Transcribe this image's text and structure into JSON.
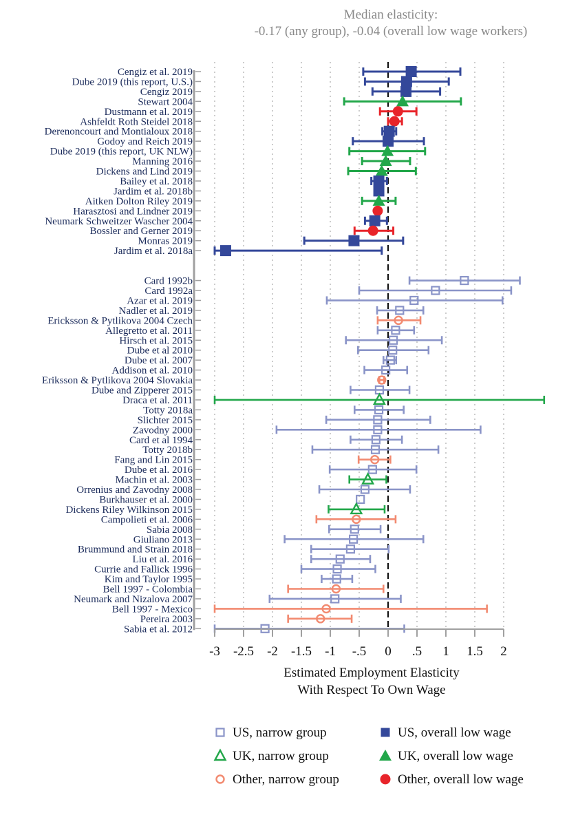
{
  "chart_data": {
    "type": "scatter",
    "subtype": "forest-plot",
    "title": "",
    "annotation": [
      "Median elasticity:",
      "-0.17 (any group), -0.04 (overall low wage workers)"
    ],
    "xlabel": [
      "Estimated Employment Elasticity",
      "With Respect To Own Wage"
    ],
    "ylabel": "",
    "xlim": [
      -3,
      2
    ],
    "xticks": [
      -3,
      -2.5,
      -2,
      -1.5,
      -1,
      -0.5,
      0,
      0.5,
      1,
      1.5,
      2
    ],
    "xtick_labels": [
      "-3",
      "-2.5",
      "-2",
      "-1.5",
      "-1",
      "-.5",
      "0",
      ".5",
      "1",
      "1.5",
      "2"
    ],
    "grid": "vertical dotted",
    "reference_line": {
      "x": 0,
      "style": "dashed",
      "color": "#111111"
    },
    "legend_position": "bottom",
    "series_styles": {
      "us_narrow": {
        "label": "US, narrow group",
        "color": "#8a94c8",
        "marker": "square-hollow"
      },
      "us_overall": {
        "label": "US, overall low wage",
        "color": "#34489a",
        "marker": "square-filled"
      },
      "uk_narrow": {
        "label": "UK, narrow group",
        "color": "#22a74a",
        "marker": "triangle-hollow"
      },
      "uk_overall": {
        "label": "UK, overall low wage",
        "color": "#22a74a",
        "marker": "triangle-filled"
      },
      "other_narrow": {
        "label": "Other, narrow group",
        "color": "#f28a70",
        "marker": "circle-hollow"
      },
      "other_overall": {
        "label": "Other, overall low wage",
        "color": "#e8242a",
        "marker": "circle-filled"
      }
    },
    "legend_order": [
      "us_narrow",
      "us_overall",
      "uk_narrow",
      "uk_overall",
      "other_narrow",
      "other_overall"
    ],
    "groups": [
      {
        "name": "overall low wage",
        "studies": [
          {
            "label": "Cengiz et al. 2019",
            "series": "us_overall",
            "estimate": 0.4,
            "ci": [
              -0.43,
              1.25
            ]
          },
          {
            "label": "Dube 2019 (this report, U.S.)",
            "series": "us_overall",
            "estimate": 0.32,
            "ci": [
              -0.4,
              1.05
            ]
          },
          {
            "label": "Cengiz 2019",
            "series": "us_overall",
            "estimate": 0.31,
            "ci": [
              -0.27,
              0.9
            ]
          },
          {
            "label": "Stewart 2004",
            "series": "uk_overall",
            "estimate": 0.25,
            "ci": [
              -0.76,
              1.26
            ]
          },
          {
            "label": "Dustmann et al. 2019",
            "series": "other_overall",
            "estimate": 0.17,
            "ci": [
              -0.14,
              0.49
            ]
          },
          {
            "label": "Ashfeldt Roth Steidel 2018",
            "series": "other_overall",
            "estimate": 0.11,
            "ci": [
              0.0,
              0.24
            ]
          },
          {
            "label": "Derenoncourt and Montialoux 2018",
            "series": "us_overall",
            "estimate": 0.02,
            "ci": [
              -0.1,
              0.14
            ]
          },
          {
            "label": "Godoy and Reich 2019",
            "series": "us_overall",
            "estimate": 0.0,
            "ci": [
              -0.61,
              0.62
            ]
          },
          {
            "label": "Dube 2019 (this report, UK NLW)",
            "series": "uk_overall",
            "estimate": -0.01,
            "ci": [
              -0.67,
              0.64
            ]
          },
          {
            "label": "Manning 2016",
            "series": "uk_overall",
            "estimate": -0.04,
            "ci": [
              -0.45,
              0.38
            ]
          },
          {
            "label": "Dickens and Lind 2019",
            "series": "uk_overall",
            "estimate": -0.11,
            "ci": [
              -0.69,
              0.48
            ]
          },
          {
            "label": "Bailey et al. 2018",
            "series": "us_overall",
            "estimate": -0.16,
            "ci": [
              -0.29,
              -0.02
            ]
          },
          {
            "label": "Jardim et al. 2018b",
            "series": "us_overall",
            "estimate": -0.16,
            "ci": [
              -0.16,
              -0.16
            ]
          },
          {
            "label": "Aitken Dolton Riley 2019",
            "series": "uk_overall",
            "estimate": -0.16,
            "ci": [
              -0.45,
              0.13
            ]
          },
          {
            "label": "Harasztosi and Lindner 2019",
            "series": "other_overall",
            "estimate": -0.18,
            "ci": [
              -0.18,
              -0.18
            ]
          },
          {
            "label": "Neumark Schweitzer Wascher 2004",
            "series": "us_overall",
            "estimate": -0.23,
            "ci": [
              -0.4,
              -0.02
            ]
          },
          {
            "label": "Bossler and Gerner 2019",
            "series": "other_overall",
            "estimate": -0.26,
            "ci": [
              -0.58,
              0.09
            ]
          },
          {
            "label": "Monras 2019",
            "series": "us_overall",
            "estimate": -0.59,
            "ci": [
              -1.45,
              0.26
            ]
          },
          {
            "label": "Jardim et al. 2018a",
            "series": "us_overall",
            "estimate": -2.81,
            "ci": [
              -3.0,
              -0.11
            ]
          }
        ]
      },
      {
        "name": "narrow group",
        "studies": [
          {
            "label": "Card 1992b",
            "series": "us_narrow",
            "estimate": 1.32,
            "ci": [
              0.37,
              2.28
            ]
          },
          {
            "label": "Card 1992a",
            "series": "us_narrow",
            "estimate": 0.82,
            "ci": [
              -0.5,
              2.13
            ]
          },
          {
            "label": "Azar et al. 2019",
            "series": "us_narrow",
            "estimate": 0.45,
            "ci": [
              -1.06,
              1.98
            ]
          },
          {
            "label": "Nadler et al. 2019",
            "series": "us_narrow",
            "estimate": 0.2,
            "ci": [
              -0.19,
              0.61
            ]
          },
          {
            "label": "Ericksson & Pytlikova 2004 Czech",
            "series": "other_narrow",
            "estimate": 0.18,
            "ci": [
              -0.18,
              0.56
            ]
          },
          {
            "label": "Allegretto et al. 2011",
            "series": "us_narrow",
            "estimate": 0.13,
            "ci": [
              -0.18,
              0.45
            ]
          },
          {
            "label": "Hirsch et al. 2015",
            "series": "us_narrow",
            "estimate": 0.09,
            "ci": [
              -0.73,
              0.93
            ]
          },
          {
            "label": "Dube et al 2010",
            "series": "us_narrow",
            "estimate": 0.08,
            "ci": [
              -0.52,
              0.7
            ]
          },
          {
            "label": "Dube et al. 2007",
            "series": "us_narrow",
            "estimate": 0.04,
            "ci": [
              -0.08,
              0.14
            ]
          },
          {
            "label": "Addison et al. 2010",
            "series": "us_narrow",
            "estimate": -0.04,
            "ci": [
              -0.41,
              0.33
            ]
          },
          {
            "label": "Eriksson & Pytlikova 2004 Slovakia",
            "series": "other_narrow",
            "estimate": -0.11,
            "ci": [
              -0.15,
              -0.07
            ]
          },
          {
            "label": "Dube and Zipperer 2015",
            "series": "us_narrow",
            "estimate": -0.15,
            "ci": [
              -0.65,
              0.37
            ]
          },
          {
            "label": "Draca et al. 2011",
            "series": "uk_narrow",
            "estimate": -0.15,
            "ci": [
              -3.0,
              2.7
            ]
          },
          {
            "label": "Totty 2018a",
            "series": "us_narrow",
            "estimate": -0.16,
            "ci": [
              -0.58,
              0.27
            ]
          },
          {
            "label": "Slichter 2015",
            "series": "us_narrow",
            "estimate": -0.18,
            "ci": [
              -1.07,
              0.73
            ]
          },
          {
            "label": "Zavodny 2000",
            "series": "us_narrow",
            "estimate": -0.18,
            "ci": [
              -1.93,
              1.6
            ]
          },
          {
            "label": "Card et al 1994",
            "series": "us_narrow",
            "estimate": -0.21,
            "ci": [
              -0.65,
              0.24
            ]
          },
          {
            "label": "Totty 2018b",
            "series": "us_narrow",
            "estimate": -0.22,
            "ci": [
              -1.31,
              0.87
            ]
          },
          {
            "label": "Fang and Lin 2015",
            "series": "other_narrow",
            "estimate": -0.23,
            "ci": [
              -0.51,
              0.04
            ]
          },
          {
            "label": "Dube et al. 2016",
            "series": "us_narrow",
            "estimate": -0.27,
            "ci": [
              -1.01,
              0.49
            ]
          },
          {
            "label": "Machin et al. 2003",
            "series": "uk_narrow",
            "estimate": -0.35,
            "ci": [
              -0.67,
              -0.03
            ]
          },
          {
            "label": "Orrenius and Zavodny 2008",
            "series": "us_narrow",
            "estimate": -0.4,
            "ci": [
              -1.19,
              0.38
            ]
          },
          {
            "label": "Burkhauser et al. 2000",
            "series": "us_narrow",
            "estimate": -0.48,
            "ci": [
              -0.48,
              -0.48
            ]
          },
          {
            "label": "Dickens Riley Wilkinson 2015",
            "series": "uk_narrow",
            "estimate": -0.55,
            "ci": [
              -1.03,
              -0.06
            ]
          },
          {
            "label": "Campolieti et al. 2006",
            "series": "other_narrow",
            "estimate": -0.55,
            "ci": [
              -1.24,
              0.13
            ]
          },
          {
            "label": "Sabia 2008",
            "series": "us_narrow",
            "estimate": -0.58,
            "ci": [
              -1.02,
              -0.13
            ]
          },
          {
            "label": "Giuliano 2013",
            "series": "us_narrow",
            "estimate": -0.6,
            "ci": [
              -1.79,
              0.61
            ]
          },
          {
            "label": "Brummund and Strain 2018",
            "series": "us_narrow",
            "estimate": -0.65,
            "ci": [
              -1.33,
              0.01
            ]
          },
          {
            "label": "Liu et al. 2016",
            "series": "us_narrow",
            "estimate": -0.83,
            "ci": [
              -1.33,
              -0.31
            ]
          },
          {
            "label": "Currie and Fallick 1996",
            "series": "us_narrow",
            "estimate": -0.88,
            "ci": [
              -1.5,
              -0.22
            ]
          },
          {
            "label": "Kim and Taylor 1995",
            "series": "us_narrow",
            "estimate": -0.89,
            "ci": [
              -1.15,
              -0.62
            ]
          },
          {
            "label": "Bell 1997 - Colombia",
            "series": "other_narrow",
            "estimate": -0.9,
            "ci": [
              -1.73,
              -0.08
            ]
          },
          {
            "label": "Neumark and Nizalova 2007",
            "series": "us_narrow",
            "estimate": -0.92,
            "ci": [
              -2.05,
              0.22
            ]
          },
          {
            "label": "Bell 1997 - Mexico",
            "series": "other_narrow",
            "estimate": -1.07,
            "ci": [
              -3.0,
              1.71
            ]
          },
          {
            "label": "Pereira 2003",
            "series": "other_narrow",
            "estimate": -1.17,
            "ci": [
              -1.73,
              -0.63
            ]
          },
          {
            "label": "Sabia et al. 2012",
            "series": "us_narrow",
            "estimate": -2.13,
            "ci": [
              -3.0,
              0.28
            ]
          }
        ]
      }
    ]
  }
}
